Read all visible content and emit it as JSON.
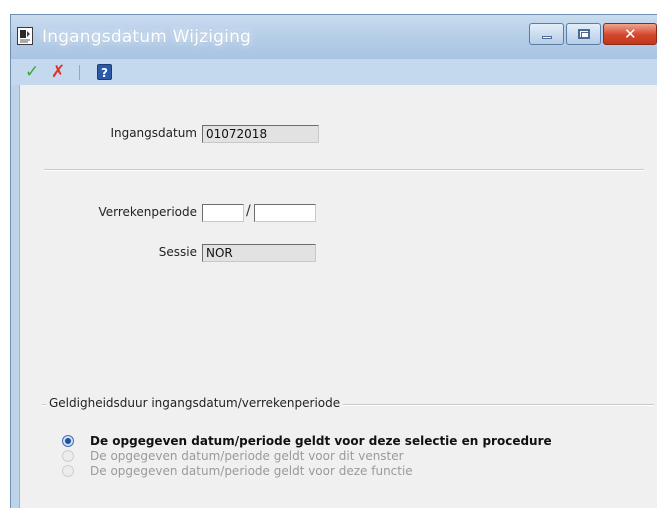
{
  "window": {
    "title": "Ingangsdatum Wijziging",
    "controls": {
      "minimize_icon": "minimize-icon",
      "maximize_icon": "maximize-icon",
      "close_glyph": "✕"
    }
  },
  "toolbar": {
    "confirm_glyph": "✓",
    "cancel_glyph": "✗",
    "help_glyph": "?"
  },
  "form": {
    "ingangsdatum": {
      "label": "Ingangsdatum",
      "value": "01072018"
    },
    "verrekenperiode": {
      "label": "Verrekenperiode",
      "value_part1": "",
      "value_part2": "",
      "separator": "/"
    },
    "sessie": {
      "label": "Sessie",
      "value": "NOR"
    }
  },
  "group": {
    "title": "Geldigheidsduur ingangsdatum/verrekenperiode",
    "options": [
      {
        "label": "De opgegeven datum/periode geldt voor deze selectie en procedure",
        "checked": true,
        "enabled": true
      },
      {
        "label": "De opgegeven datum/periode geldt voor dit venster",
        "checked": false,
        "enabled": false
      },
      {
        "label": "De opgegeven datum/periode geldt voor deze functie",
        "checked": false,
        "enabled": false
      }
    ]
  },
  "colors": {
    "titlebar": "#b4cce6",
    "close_button": "#d2472c",
    "content_background": "#f0f0f0",
    "confirm": "#3fa63a",
    "cancel": "#e03028"
  }
}
